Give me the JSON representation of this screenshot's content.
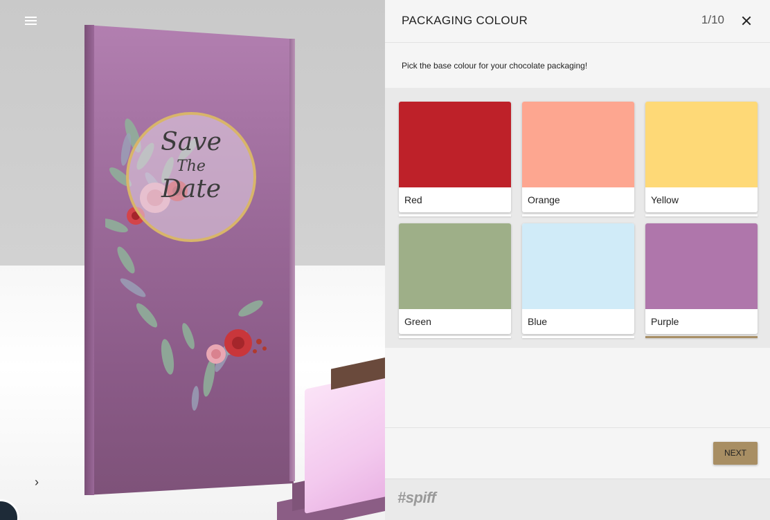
{
  "preview": {
    "product_text": {
      "line1": "Save",
      "line2": "The",
      "line3": "Date"
    }
  },
  "panel": {
    "title": "PACKAGING COLOUR",
    "step": "1/10",
    "instruction": "Pick the base colour for your chocolate packaging!",
    "options": [
      {
        "label": "Red",
        "color": "#be2129",
        "selected": false
      },
      {
        "label": "Orange",
        "color": "#fda690",
        "selected": false
      },
      {
        "label": "Yellow",
        "color": "#fed977",
        "selected": false
      },
      {
        "label": "Green",
        "color": "#9eaf88",
        "selected": false
      },
      {
        "label": "Blue",
        "color": "#d0ebf8",
        "selected": false
      },
      {
        "label": "Purple",
        "color": "#af76ab",
        "selected": true
      }
    ],
    "next_label": "NEXT",
    "accent_color": "#a88e63"
  },
  "brand": {
    "logo_text": "#spiff"
  }
}
